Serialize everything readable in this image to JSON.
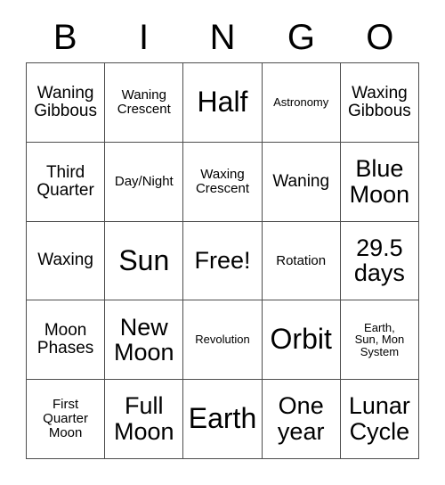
{
  "card": {
    "title": "BINGO",
    "header_letters": [
      "B",
      "I",
      "N",
      "G",
      "O"
    ],
    "grid_size": "5x5",
    "border_color": "#4d4d4d",
    "background_color": "#ffffff",
    "text_color": "#000000"
  },
  "cells": [
    {
      "text": "Waning\nGibbous",
      "size": "md"
    },
    {
      "text": "Waning\nCrescent",
      "size": "sm"
    },
    {
      "text": "Half",
      "size": "xxl"
    },
    {
      "text": "Astronomy",
      "size": "xs"
    },
    {
      "text": "Waxing\nGibbous",
      "size": "md"
    },
    {
      "text": "Third\nQuarter",
      "size": "md"
    },
    {
      "text": "Day/Night",
      "size": "sm"
    },
    {
      "text": "Waxing\nCrescent",
      "size": "sm"
    },
    {
      "text": "Waning",
      "size": "md"
    },
    {
      "text": "Blue\nMoon",
      "size": "xl"
    },
    {
      "text": "Waxing",
      "size": "md"
    },
    {
      "text": "Sun",
      "size": "xxl"
    },
    {
      "text": "Free!",
      "size": "xl"
    },
    {
      "text": "Rotation",
      "size": "sm"
    },
    {
      "text": "29.5\ndays",
      "size": "xl"
    },
    {
      "text": "Moon\nPhases",
      "size": "md"
    },
    {
      "text": "New\nMoon",
      "size": "xl"
    },
    {
      "text": "Revolution",
      "size": "xs"
    },
    {
      "text": "Orbit",
      "size": "xxl"
    },
    {
      "text": "Earth,\nSun, Mon\nSystem",
      "size": "xs"
    },
    {
      "text": "First\nQuarter\nMoon",
      "size": "sm"
    },
    {
      "text": "Full\nMoon",
      "size": "xl"
    },
    {
      "text": "Earth",
      "size": "xxl"
    },
    {
      "text": "One\nyear",
      "size": "xl"
    },
    {
      "text": "Lunar\nCycle",
      "size": "xl"
    }
  ]
}
